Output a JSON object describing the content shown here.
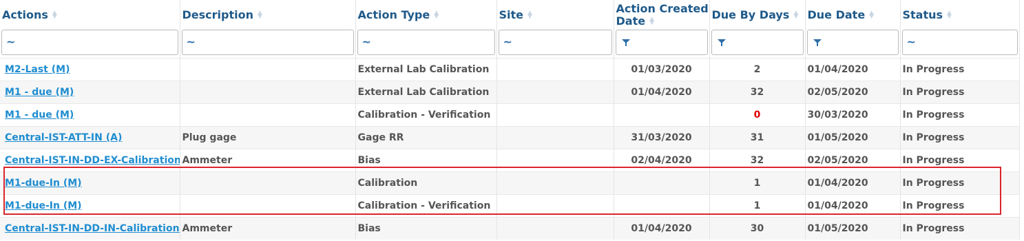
{
  "columns": [
    {
      "label": "Actions",
      "filter": "tilde"
    },
    {
      "label": "Description",
      "filter": "tilde"
    },
    {
      "label": "Action Type",
      "filter": "tilde"
    },
    {
      "label": "Site",
      "filter": "tilde"
    },
    {
      "label": "Action Created Date",
      "filter": "funnel"
    },
    {
      "label": "Due By Days",
      "filter": "funnel"
    },
    {
      "label": "Due Date",
      "filter": "funnel"
    },
    {
      "label": "Status",
      "filter": "tilde"
    }
  ],
  "filter_symbol": "~",
  "rows": [
    {
      "action": "M2-Last (M)",
      "description": "",
      "type": "External Lab Calibration",
      "site": "",
      "created": "01/03/2020",
      "due_days": "2",
      "due_date": "01/04/2020",
      "status": "In Progress"
    },
    {
      "action": "M1 - due (M)",
      "description": "",
      "type": "External Lab Calibration",
      "site": "",
      "created": "01/04/2020",
      "due_days": "32",
      "due_date": "02/05/2020",
      "status": "In Progress"
    },
    {
      "action": "M1 - due (M)",
      "description": "",
      "type": "Calibration - Verification",
      "site": "",
      "created": "",
      "due_days": "0",
      "due_date": "30/03/2020",
      "status": "In Progress"
    },
    {
      "action": "Central-IST-ATT-IN (A)",
      "description": "Plug gage",
      "type": "Gage RR",
      "site": "",
      "created": "31/03/2020",
      "due_days": "31",
      "due_date": "01/05/2020",
      "status": "In Progress"
    },
    {
      "action": "Central-IST-IN-DD-EX-Calibration-D",
      "description": "Ammeter",
      "type": "Bias",
      "site": "",
      "created": "02/04/2020",
      "due_days": "32",
      "due_date": "02/05/2020",
      "status": "In Progress"
    },
    {
      "action": "M1-due-In (M)",
      "description": "",
      "type": "Calibration",
      "site": "",
      "created": "",
      "due_days": "1",
      "due_date": "01/04/2020",
      "status": "In Progress"
    },
    {
      "action": "M1-due-In (M)",
      "description": "",
      "type": "Calibration - Verification",
      "site": "",
      "created": "",
      "due_days": "1",
      "due_date": "01/04/2020",
      "status": "In Progress"
    },
    {
      "action": "Central-IST-IN-DD-IN-Calibration-D",
      "description": "Ammeter",
      "type": "Bias",
      "site": "",
      "created": "01/04/2020",
      "due_days": "30",
      "due_date": "01/05/2020",
      "status": "In Progress"
    }
  ],
  "colors": {
    "header": "#1f5a8a",
    "link": "#1f8dd0",
    "overdue": "#e00000",
    "highlight_border": "#d9262c"
  }
}
